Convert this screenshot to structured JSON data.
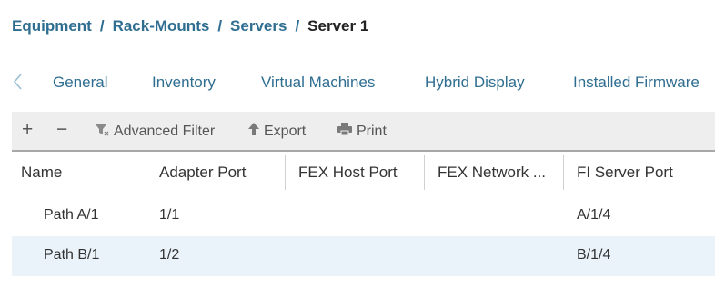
{
  "breadcrumb": {
    "items": [
      "Equipment",
      "Rack-Mounts",
      "Servers"
    ],
    "separator": "/",
    "current": "Server 1"
  },
  "tabs": {
    "items": [
      "General",
      "Inventory",
      "Virtual Machines",
      "Hybrid Display",
      "Installed Firmware"
    ]
  },
  "toolbar": {
    "add_label": "+",
    "remove_label": "−",
    "filter_label": "Advanced Filter",
    "export_label": "Export",
    "print_label": "Print"
  },
  "table": {
    "columns": [
      "Name",
      "Adapter Port",
      "FEX Host Port",
      "FEX Network ...",
      "FI Server Port"
    ],
    "rows": [
      [
        "Path A/1",
        "1/1",
        "",
        "",
        "A/1/4"
      ],
      [
        "Path B/1",
        "1/2",
        "",
        "",
        "B/1/4"
      ]
    ]
  },
  "colors": {
    "link": "#2f6e91",
    "toolbar_bg": "#eeeeee",
    "row_alt_bg": "#eaf3fa"
  }
}
